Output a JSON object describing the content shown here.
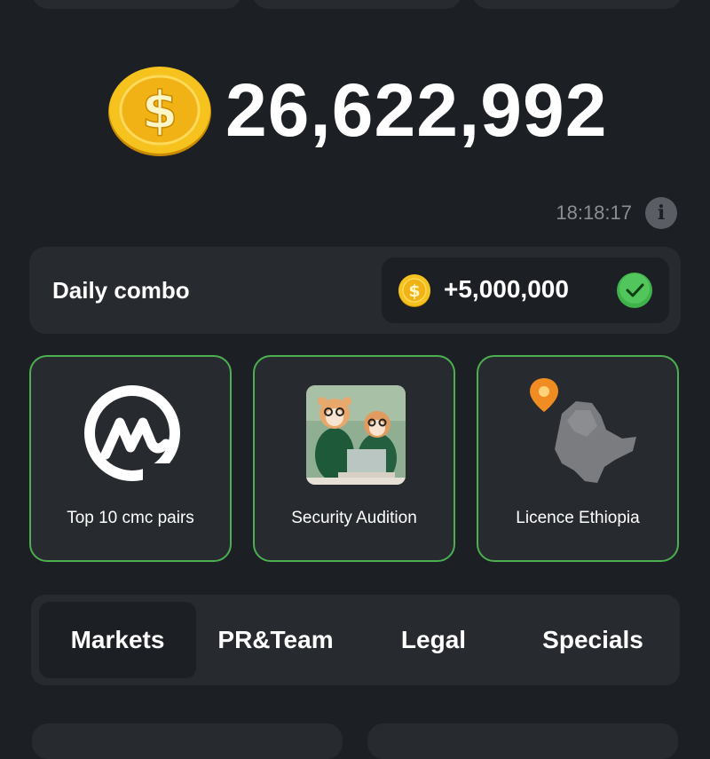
{
  "balance": {
    "value": "26,622,992",
    "icon": "dollar-coin-icon"
  },
  "timer": {
    "value": "18:18:17"
  },
  "daily_combo": {
    "label": "Daily combo",
    "reward": "+5,000,000",
    "completed": true
  },
  "cards": [
    {
      "label": "Top 10 cmc pairs",
      "icon": "coinmarketcap-logo"
    },
    {
      "label": "Security Audition",
      "icon": "hamsters-at-laptop-image"
    },
    {
      "label": "Licence Ethiopia",
      "icon": "ethiopia-map-image"
    }
  ],
  "tabs": [
    {
      "label": "Markets",
      "active": true
    },
    {
      "label": "PR&Team",
      "active": false
    },
    {
      "label": "Legal",
      "active": false
    },
    {
      "label": "Specials",
      "active": false
    }
  ],
  "colors": {
    "background": "#1c1f24",
    "card": "#272a2f",
    "accent_green": "#4caf50",
    "coin_gold": "#f2b318"
  }
}
